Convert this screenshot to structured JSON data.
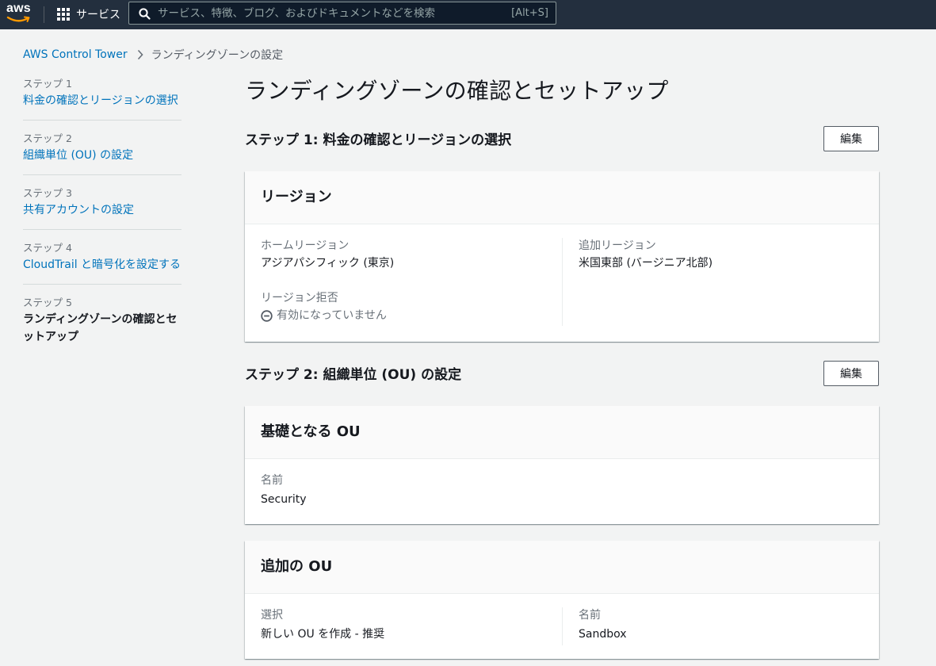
{
  "topnav": {
    "logo_text": "aws",
    "services_label": "サービス",
    "search_placeholder": "サービス、特徴、ブログ、およびドキュメントなどを検索",
    "search_shortcut": "[Alt+S]"
  },
  "breadcrumb": {
    "root": "AWS Control Tower",
    "current": "ランディングゾーンの設定"
  },
  "steps": [
    {
      "num": "ステップ 1",
      "label": "料金の確認とリージョンの選択"
    },
    {
      "num": "ステップ 2",
      "label": "組織単位 (OU) の設定"
    },
    {
      "num": "ステップ 3",
      "label": "共有アカウントの設定"
    },
    {
      "num": "ステップ 4",
      "label": "CloudTrail と暗号化を設定する"
    },
    {
      "num": "ステップ 5",
      "label": "ランディングゾーンの確認とセットアップ"
    }
  ],
  "main": {
    "title": "ランディングゾーンの確認とセットアップ",
    "section1": {
      "title": "ステップ 1: 料金の確認とリージョンの選択",
      "edit_label": "編集",
      "card": {
        "title": "リージョン",
        "home_region_label": "ホームリージョン",
        "home_region_value": "アジアパシフィック (東京)",
        "deny_label": "リージョン拒否",
        "deny_value": "有効になっていません",
        "additional_label": "追加リージョン",
        "additional_value": "米国東部 (バージニア北部)"
      }
    },
    "section2": {
      "title": "ステップ 2: 組織単位 (OU) の設定",
      "edit_label": "編集",
      "foundational_card": {
        "title": "基礎となる OU",
        "name_label": "名前",
        "name_value": "Security"
      },
      "additional_card": {
        "title": "追加の OU",
        "select_label": "選択",
        "select_value": "新しい OU を作成 - 推奨",
        "name_label": "名前",
        "name_value": "Sandbox"
      }
    }
  },
  "colors": {
    "nav_bg": "#232f3e",
    "link": "#0073bb",
    "aws_orange": "#ff9900"
  }
}
